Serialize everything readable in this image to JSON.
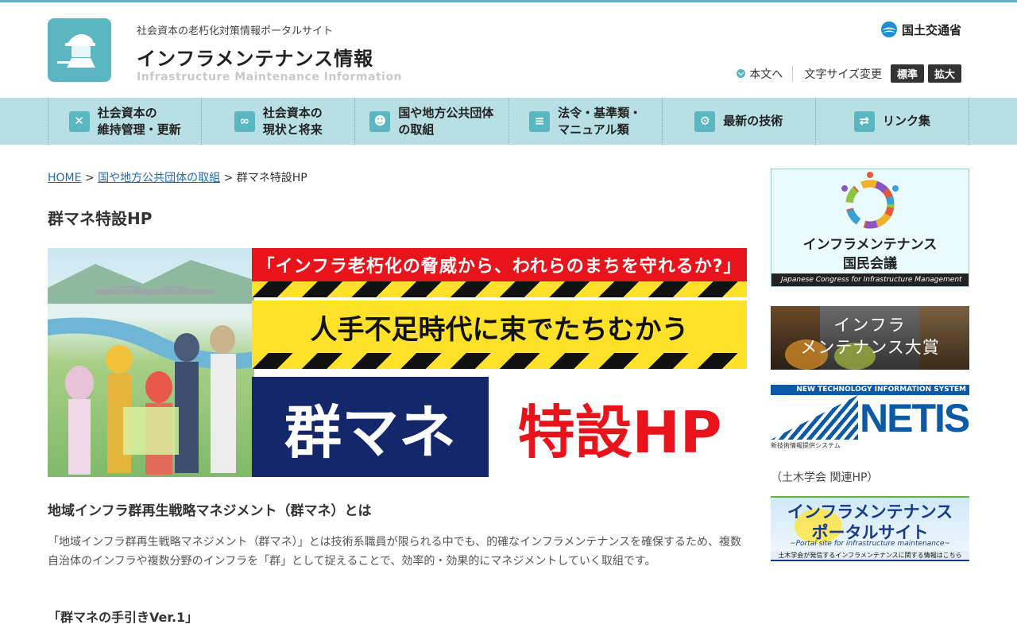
{
  "header": {
    "subtitle": "社会資本の老朽化対策情報ポータルサイト",
    "title": "インフラメンテナンス情報",
    "title_en": "Infrastructure Maintenance Information",
    "ministry": "国土交通省",
    "skip_link": "本文へ",
    "font_size_label": "文字サイズ変更",
    "font_size_standard": "標準",
    "font_size_large": "拡大"
  },
  "nav": {
    "items": [
      {
        "line1": "社会資本の",
        "line2": "維持管理・更新",
        "icon": "tools-icon"
      },
      {
        "line1": "社会資本の",
        "line2": "現状と将来",
        "icon": "binoculars-icon"
      },
      {
        "line1": "国や地方公共団体",
        "line2": "の取組",
        "icon": "people-icon"
      },
      {
        "line1": "法令・基準類・",
        "line2": "マニュアル類",
        "icon": "document-icon"
      },
      {
        "line1": "最新の技術",
        "line2": "",
        "icon": "robot-icon"
      },
      {
        "line1": "リンク集",
        "line2": "",
        "icon": "link-icon"
      }
    ]
  },
  "breadcrumb": {
    "home": "HOME",
    "sep": ">",
    "parent": "国や地方公共団体の取組",
    "current": "群マネ特設HP"
  },
  "main": {
    "page_title": "群マネ特設HP",
    "banner": {
      "headline": "「インフラ老朽化の脅威から、われらのまちを守れるか?」",
      "tagline": "人手不足時代に束でたちむかう",
      "logo_left": "群マネ",
      "logo_right": "特設HP"
    },
    "section_heading": "地域インフラ群再生戦略マネジメント（群マネ）とは",
    "body": "「地域インフラ群再生戦略マネジメント（群マネ）」とは技術系職員が限られる中でも、的確なインフラメンテナンスを確保するため、複数自治体のインフラや複数分野のインフラを「群」として捉えることで、効率的・効果的にマネジメントしていく取組です。",
    "sub_heading": "「群マネの手引きVer.1」"
  },
  "sidebar": {
    "banner1_title": "インフラメンテナンス",
    "banner1_sub": "国民会議",
    "banner1_en": "Japanese Congress for Infrastructure Management",
    "banner2_line1": "インフラ",
    "banner2_line2": "メンテナンス大賞",
    "banner3_head": "NEW TECHNOLOGY INFORMATION SYSTEM",
    "banner3_logo": "NETIS",
    "banner3_foot": "新技術情報提供システム",
    "related_label": "（土木学会 関連HP）",
    "banner4_line1": "インフラメンテナンス",
    "banner4_line2": "ポータルサイト",
    "banner4_en": "~Portal site for infrastructure maintenance~",
    "banner4_foot": "土木学会が発信するインフラメンテナンスに関する情報はこちら"
  },
  "colors": {
    "accent": "#5ab6c1",
    "nav_bg": "#b8e0e4",
    "link": "#2a6aa8",
    "banner_red": "#e8131b",
    "banner_yellow": "#ffe12a",
    "banner_navy": "#13276a"
  }
}
